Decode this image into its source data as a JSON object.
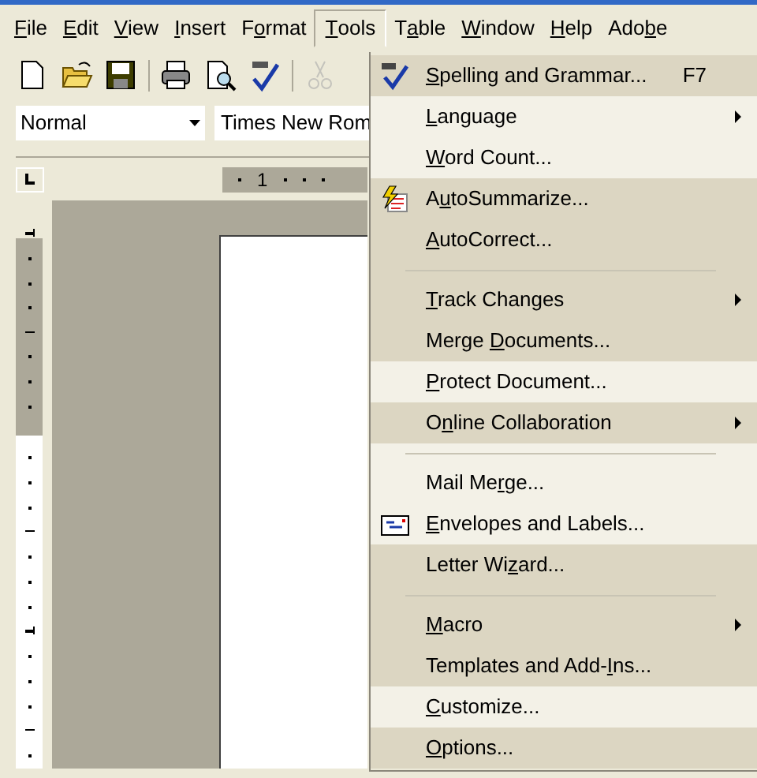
{
  "menu_bar": [
    {
      "key": "F",
      "post": "ile",
      "selected": false
    },
    {
      "key": "E",
      "post": "dit",
      "selected": false
    },
    {
      "key": "V",
      "post": "iew",
      "selected": false
    },
    {
      "key": "I",
      "post": "nsert",
      "selected": false
    },
    {
      "pre": "F",
      "key": "o",
      "post": "rmat",
      "selected": false
    },
    {
      "key": "T",
      "post": "ools",
      "selected": true
    },
    {
      "pre": "T",
      "key": "a",
      "post": "ble",
      "selected": false
    },
    {
      "key": "W",
      "post": "indow",
      "selected": false
    },
    {
      "key": "H",
      "post": "elp",
      "selected": false
    },
    {
      "pre": "Ado",
      "key": "b",
      "post": "e",
      "selected": false
    }
  ],
  "toolbar": [
    {
      "kind": "new",
      "disabled": false
    },
    {
      "kind": "open",
      "disabled": false
    },
    {
      "kind": "save",
      "disabled": false
    },
    {
      "kind": "separator"
    },
    {
      "kind": "print",
      "disabled": false
    },
    {
      "kind": "preview",
      "disabled": false
    },
    {
      "kind": "spelling",
      "disabled": false
    },
    {
      "kind": "separator"
    },
    {
      "kind": "cut",
      "disabled": true
    }
  ],
  "style_box": {
    "value": "Normal"
  },
  "font_box": {
    "value": "Times New Rom"
  },
  "ruler": {
    "label": "1"
  },
  "tools_menu": [
    {
      "kind": "spelling",
      "key": "S",
      "post": "pelling and Grammar...",
      "shortcut": "F7",
      "submenu": false,
      "rarely_used": false
    },
    {
      "kind": "item",
      "key": "L",
      "post": "anguage",
      "submenu": true,
      "rarely_used": true
    },
    {
      "kind": "item",
      "key": "W",
      "post": "ord Count...",
      "submenu": false,
      "rarely_used": true
    },
    {
      "kind": "summarize",
      "pre": "A",
      "key": "u",
      "post": "toSummarize...",
      "submenu": false,
      "rarely_used": false
    },
    {
      "kind": "item",
      "key": "A",
      "post": "utoCorrect...",
      "submenu": false,
      "rarely_used": false
    },
    {
      "kind": "separator",
      "rarely_used": false
    },
    {
      "kind": "item",
      "key": "T",
      "post": "rack Changes",
      "submenu": true,
      "rarely_used": false
    },
    {
      "kind": "item",
      "pre": "Merge ",
      "key": "D",
      "post": "ocuments...",
      "submenu": false,
      "rarely_used": false
    },
    {
      "kind": "item",
      "key": "P",
      "post": "rotect Document...",
      "submenu": false,
      "rarely_used": true
    },
    {
      "kind": "item",
      "pre": "O",
      "key": "n",
      "post": "line Collaboration",
      "submenu": true,
      "rarely_used": false
    },
    {
      "kind": "separator",
      "rarely_used": true
    },
    {
      "kind": "item",
      "pre": "Mail Me",
      "key": "r",
      "post": "ge...",
      "submenu": false,
      "rarely_used": true
    },
    {
      "kind": "envelope",
      "key": "E",
      "post": "nvelopes and Labels...",
      "submenu": false,
      "rarely_used": true
    },
    {
      "kind": "item",
      "pre": "Letter Wi",
      "key": "z",
      "post": "ard...",
      "submenu": false,
      "rarely_used": false
    },
    {
      "kind": "separator",
      "rarely_used": false
    },
    {
      "kind": "item",
      "key": "M",
      "post": "acro",
      "submenu": true,
      "rarely_used": false
    },
    {
      "kind": "item",
      "pre": "Templates and Add-",
      "key": "I",
      "post": "ns...",
      "submenu": false,
      "rarely_used": false
    },
    {
      "kind": "item",
      "key": "C",
      "post": "ustomize...",
      "submenu": false,
      "rarely_used": true
    },
    {
      "kind": "item",
      "key": "O",
      "post": "ptions...",
      "submenu": false,
      "rarely_used": false
    }
  ]
}
